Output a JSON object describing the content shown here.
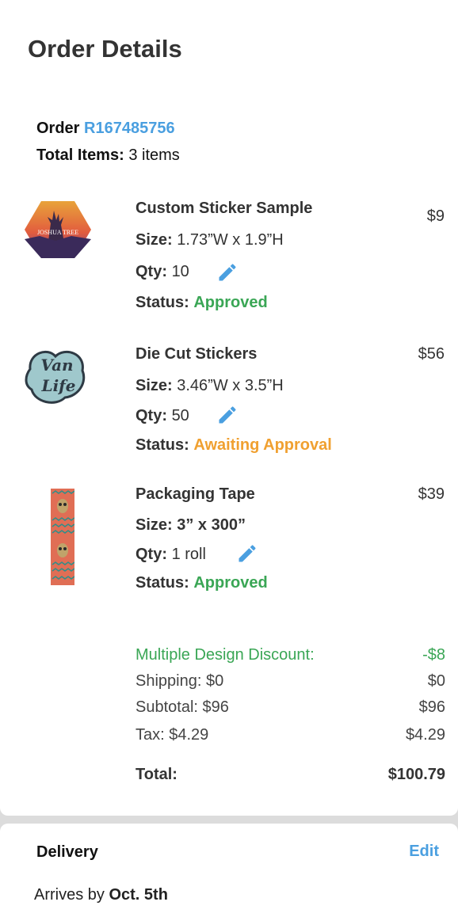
{
  "header": {
    "title": "Order Details"
  },
  "order": {
    "label": "Order",
    "number": "R167485756",
    "total_items_label": "Total Items:",
    "total_items_value": "3 items"
  },
  "labels": {
    "size": "Size:",
    "qty": "Qty:",
    "status": "Status:"
  },
  "items": [
    {
      "name": "Custom Sticker Sample",
      "price": "$9",
      "size": "1.73”W x 1.9”H",
      "qty": "10",
      "status": "Approved",
      "status_color": "#3aa655",
      "thumb_text": "JOSHUA TREE"
    },
    {
      "name": "Die Cut Stickers",
      "price": "$56",
      "size": "3.46”W x 3.5”H",
      "qty": "50",
      "status": "Awaiting Approval",
      "status_color": "#f0a030",
      "thumb_text": "Van Life"
    },
    {
      "name": "Packaging Tape",
      "price": "$39",
      "size": "3” x 300”",
      "qty": "1 roll",
      "status": "Approved",
      "status_color": "#3aa655"
    }
  ],
  "summary": {
    "discount_label": "Multiple Design Discount:",
    "discount_value": "-$8",
    "shipping_label": "Shipping: $0",
    "shipping_value": "$0",
    "subtotal_label": "Subtotal: $96",
    "subtotal_value": "$96",
    "tax_label": "Tax: $4.29",
    "tax_value": "$4.29",
    "total_label": "Total:",
    "total_value": "$100.79"
  },
  "delivery": {
    "title": "Delivery",
    "edit_label": "Edit",
    "arrives_prefix": "Arrives by",
    "arrives_date": "Oct. 5th"
  },
  "colors": {
    "accent": "#4a9fe0",
    "approved": "#3aa655",
    "awaiting": "#f0a030"
  }
}
